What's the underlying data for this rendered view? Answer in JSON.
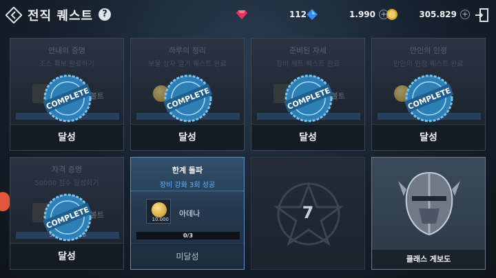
{
  "header": {
    "title": "전직 퀘스트",
    "help_label": "?",
    "currencies": [
      {
        "icon": "ruby-gem-icon",
        "value": "112"
      },
      {
        "icon": "blue-diamond-icon",
        "value": "1.990"
      },
      {
        "icon": "gold-coin-icon",
        "value": "305.829"
      }
    ],
    "plus_label": "+"
  },
  "cards": [
    {
      "name": "안내의 증명",
      "desc": "조스 확보 완료하기",
      "reward": "사일 볼트",
      "progress": "200/200",
      "status": "달성",
      "stamp": "COMPLETE"
    },
    {
      "name": "하루의 정리",
      "desc": "보물 상자 열기 퀘스트 완료",
      "reward": "",
      "progress": "1/1",
      "status": "달성",
      "stamp": "COMPLETE"
    },
    {
      "name": "준비된 자세",
      "desc": "장비 세트 퀘스트 완료",
      "reward": "사일 볼트",
      "progress": "1/1",
      "status": "달성",
      "stamp": "COMPLETE"
    },
    {
      "name": "만인의 인정",
      "desc": "만인의 인정 퀘스트 완료",
      "reward": "",
      "progress": "5/5",
      "status": "달성",
      "stamp": "COMPLETE"
    },
    {
      "name": "자격 증명",
      "desc": "50000 점수 달성하기",
      "reward": "사일 볼트",
      "progress": "50000/50000",
      "status": "달성",
      "stamp": "COMPLETE"
    }
  ],
  "active_card": {
    "name": "한계 돌파",
    "desc": "장비 강화 3회 성공",
    "item_qty": "10.000",
    "item_name": "아데나",
    "progress": "0/3",
    "status": "미달성"
  },
  "locked_card": {
    "number": "7"
  },
  "board_card": {
    "label": "클래스 게보도"
  },
  "colors": {
    "accent_blue": "#5fb3ff",
    "progress_blue": "#2c4b70",
    "gold": "#d9a83a"
  }
}
